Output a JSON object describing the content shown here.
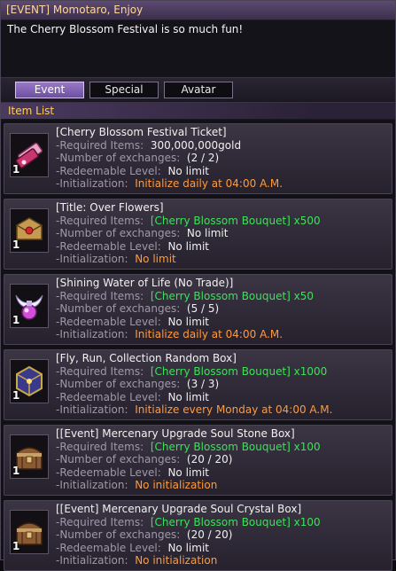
{
  "window": {
    "title": "[EVENT] Momotaro, Enjoy"
  },
  "message": "The Cherry Blossom Festival is so much fun!",
  "tabs": [
    {
      "label": "Event",
      "active": true
    },
    {
      "label": "Special",
      "active": false
    },
    {
      "label": "Avatar",
      "active": false
    }
  ],
  "section_title": "Item List",
  "labels": {
    "required": "-Required Items:",
    "exchanges": "-Number of exchanges:",
    "level": "-Redeemable Level:",
    "init": "-Initialization:"
  },
  "items": [
    {
      "name": "[Cherry Blossom Festival Ticket]",
      "icon": "ticket-icon",
      "qty": "1",
      "required": "300,000,000gold",
      "exchanges": "(2 / 2)",
      "level": "No limit",
      "init": "Initialize daily at 04:00 A.M."
    },
    {
      "name": "[Title: Over Flowers]",
      "icon": "title-scroll-icon",
      "qty": "1",
      "required": "[Cherry Blossom Bouquet] x500",
      "exchanges": "No limit",
      "level": "No limit",
      "init": "No limit"
    },
    {
      "name": "[Shining Water of Life (No Trade)]",
      "icon": "potion-icon",
      "qty": "1",
      "required": "[Cherry Blossom Bouquet] x50",
      "exchanges": "(5 / 5)",
      "level": "No limit",
      "init": "Initialize daily at 04:00 A.M."
    },
    {
      "name": "[Fly, Run, Collection Random Box]",
      "icon": "random-box-icon",
      "qty": "1",
      "required": "[Cherry Blossom Bouquet] x1000",
      "exchanges": "(3 / 3)",
      "level": "No limit",
      "init": "Initialize every Monday at 04:00 A.M."
    },
    {
      "name": "[[Event] Mercenary Upgrade Soul Stone Box]",
      "icon": "treasure-chest-icon",
      "qty": "1",
      "required": "[Cherry Blossom Bouquet] x100",
      "exchanges": "(20 / 20)",
      "level": "No limit",
      "init": "No initialization"
    },
    {
      "name": "[[Event] Mercenary Upgrade Soul Crystal Box]",
      "icon": "treasure-chest-icon",
      "qty": "1",
      "required": "[Cherry Blossom Bouquet] x100",
      "exchanges": "(20 / 20)",
      "level": "No limit",
      "init": "No initialization"
    }
  ],
  "colors": {
    "title_text": "#ffd79a",
    "section_text": "#ffcc66",
    "required_green": "#3ee05a",
    "init_orange": "#ff9a3c",
    "label_gray": "#9f98a9"
  }
}
